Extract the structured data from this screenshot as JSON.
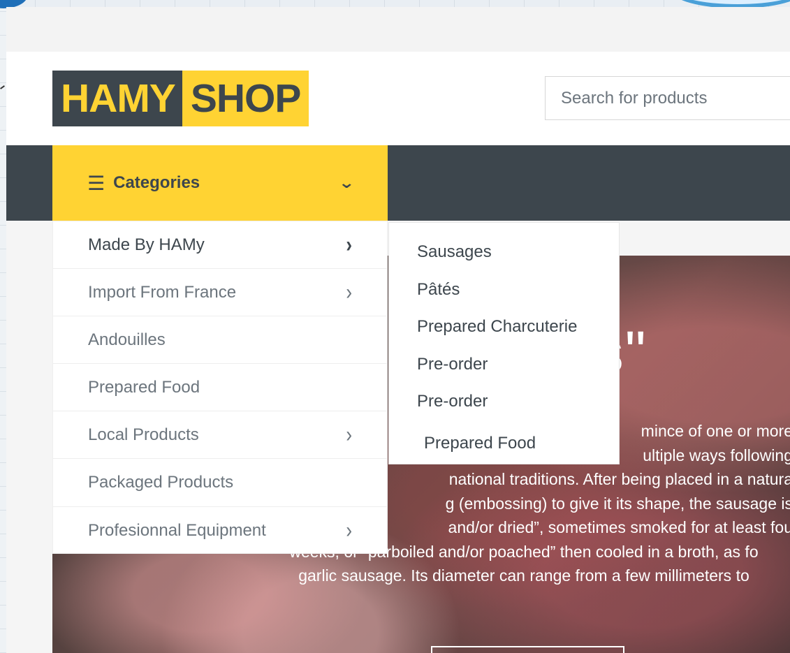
{
  "logo": {
    "part1": "HAMY",
    "part2": "SHOP"
  },
  "search": {
    "placeholder": "Search for products"
  },
  "categories_button": {
    "label": "Categories"
  },
  "categories": [
    {
      "label": "Made By HAMy",
      "has_submenu": true
    },
    {
      "label": "Import From France",
      "has_submenu": true
    },
    {
      "label": "Andouilles",
      "has_submenu": false
    },
    {
      "label": "Prepared Food",
      "has_submenu": false
    },
    {
      "label": "Local Products",
      "has_submenu": true
    },
    {
      "label": "Packaged Products",
      "has_submenu": false
    },
    {
      "label": "Profesionnal Equipment",
      "has_submenu": true
    }
  ],
  "submenu": [
    "Sausages",
    "Pâtés",
    "Prepared Charcuterie",
    "Pre-order",
    "Pre-order",
    "Prepared Food"
  ],
  "hero": {
    "title": "ns\"",
    "lines": [
      "mince of one or more",
      "ultiple ways following",
      "national traditions. After being placed in a natura",
      "g (embossing) to give it its shape, the sausage is",
      "and/or dried”, sometimes smoked for at least fou",
      "weeks, or “parboiled and/or poached” then cooled in a broth, as fo",
      "garlic sausage. Its diameter can range from a few millimeters to"
    ]
  },
  "colors": {
    "brand_yellow": "#ffd333",
    "brand_dark": "#3d464d",
    "muted_text": "#6c757d"
  }
}
